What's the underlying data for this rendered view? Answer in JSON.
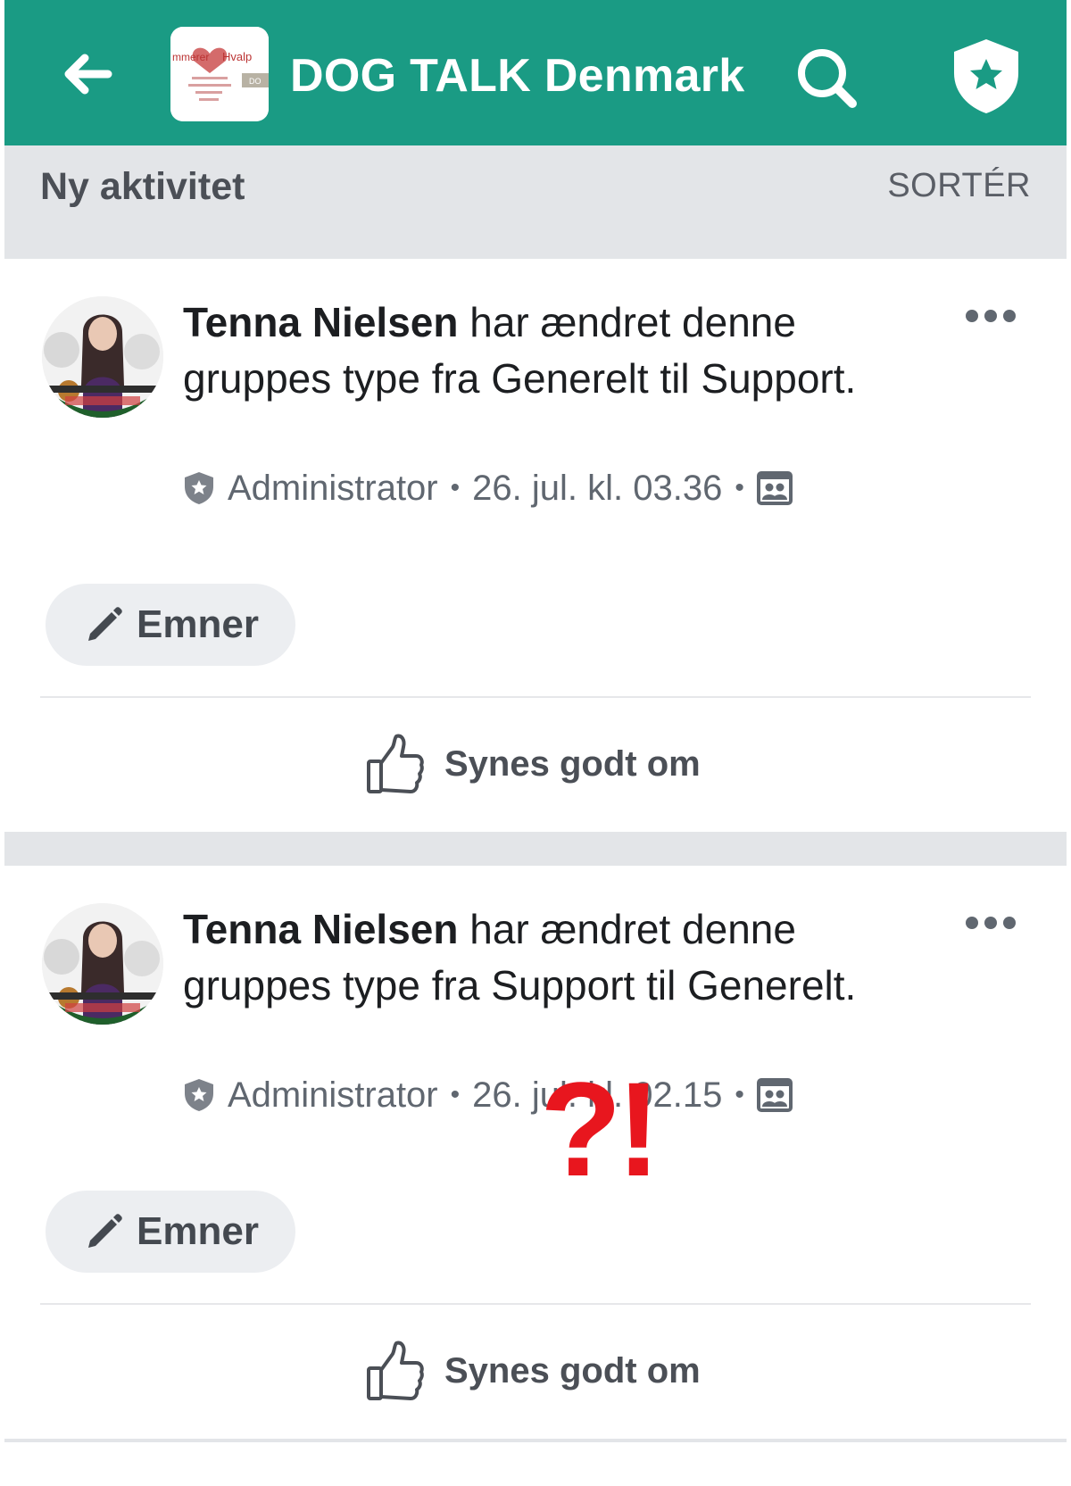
{
  "header": {
    "title": "DOG TALK Denmark",
    "thumb_text_1": "mmerer",
    "thumb_text_2": "Hvalp",
    "thumb_text_3": "DO"
  },
  "feed": {
    "section_title": "Ny aktivitet",
    "sort_label": "SORTÉR"
  },
  "posts": [
    {
      "author": "Tenna Nielsen",
      "text": " har ændret denne gruppes type fra Generelt til Support.",
      "role": "Administrator",
      "timestamp": "26. jul. kl. 03.36",
      "topics_label": "Emner",
      "like_label": "Synes godt om"
    },
    {
      "author": "Tenna Nielsen",
      "text": " har ændret denne gruppes type fra Support til Generelt.",
      "role": "Administrator",
      "timestamp": "26. jul. kl. 02.15",
      "topics_label": "Emner",
      "like_label": "Synes godt om",
      "annotation": "?!"
    }
  ],
  "colors": {
    "header_bg": "#1a9b84",
    "section_bg": "#e3e5e8",
    "annotation": "#e8161e"
  },
  "icons": [
    "back-arrow-icon",
    "search-icon",
    "admin-shield-star-icon",
    "more-options-icon",
    "shield-star-icon",
    "group-members-icon",
    "pencil-icon",
    "thumbs-up-icon"
  ]
}
